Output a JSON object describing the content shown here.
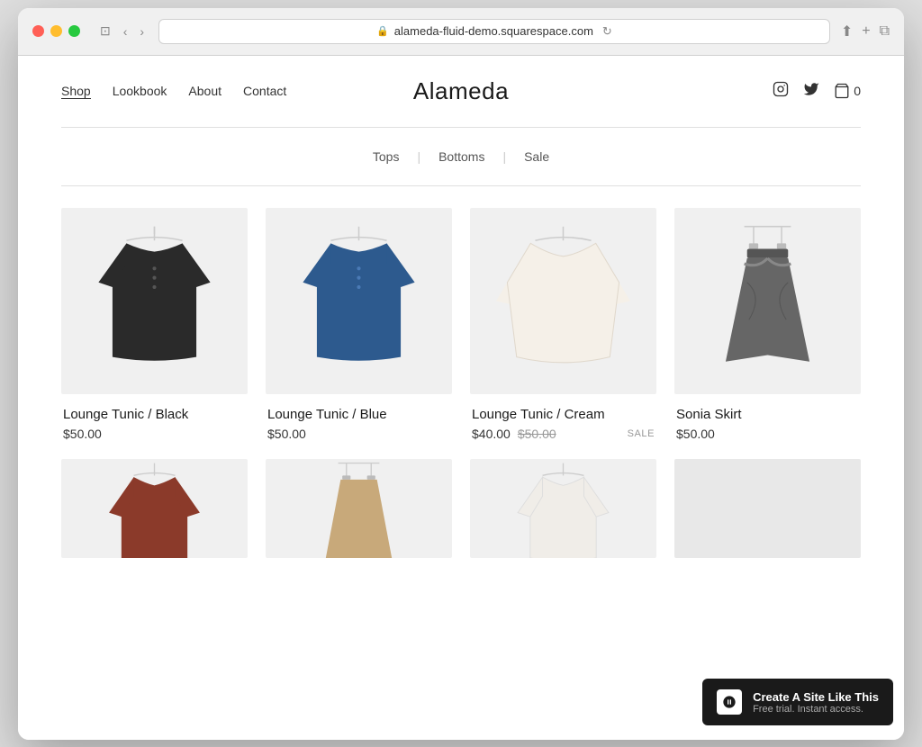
{
  "browser": {
    "url": "alameda-fluid-demo.squarespace.com",
    "back_label": "‹",
    "forward_label": "›"
  },
  "site": {
    "title": "Alameda"
  },
  "nav": {
    "left": [
      {
        "label": "Shop",
        "active": true
      },
      {
        "label": "Lookbook",
        "active": false
      },
      {
        "label": "About",
        "active": false
      },
      {
        "label": "Contact",
        "active": false
      }
    ],
    "cart_count": "0"
  },
  "categories": [
    {
      "label": "Tops"
    },
    {
      "label": "Bottoms"
    },
    {
      "label": "Sale"
    }
  ],
  "products": [
    {
      "name": "Lounge Tunic / Black",
      "price": "$50.00",
      "original_price": null,
      "sale": false,
      "color": "black"
    },
    {
      "name": "Lounge Tunic / Blue",
      "price": "$50.00",
      "original_price": null,
      "sale": false,
      "color": "blue"
    },
    {
      "name": "Lounge Tunic / Cream",
      "price": "$40.00",
      "original_price": "$50.00",
      "sale": true,
      "color": "cream"
    },
    {
      "name": "Sonia Skirt",
      "price": "$50.00",
      "original_price": null,
      "sale": false,
      "color": "gray"
    }
  ],
  "bottom_products": [
    {
      "color": "rust",
      "partial": true
    },
    {
      "color": "tan",
      "partial": true
    },
    {
      "color": "white",
      "partial": true
    },
    {
      "color": "gray",
      "partial": true
    }
  ],
  "squarespace_banner": {
    "main": "Create A Site Like This",
    "sub": "Free trial. Instant access."
  }
}
